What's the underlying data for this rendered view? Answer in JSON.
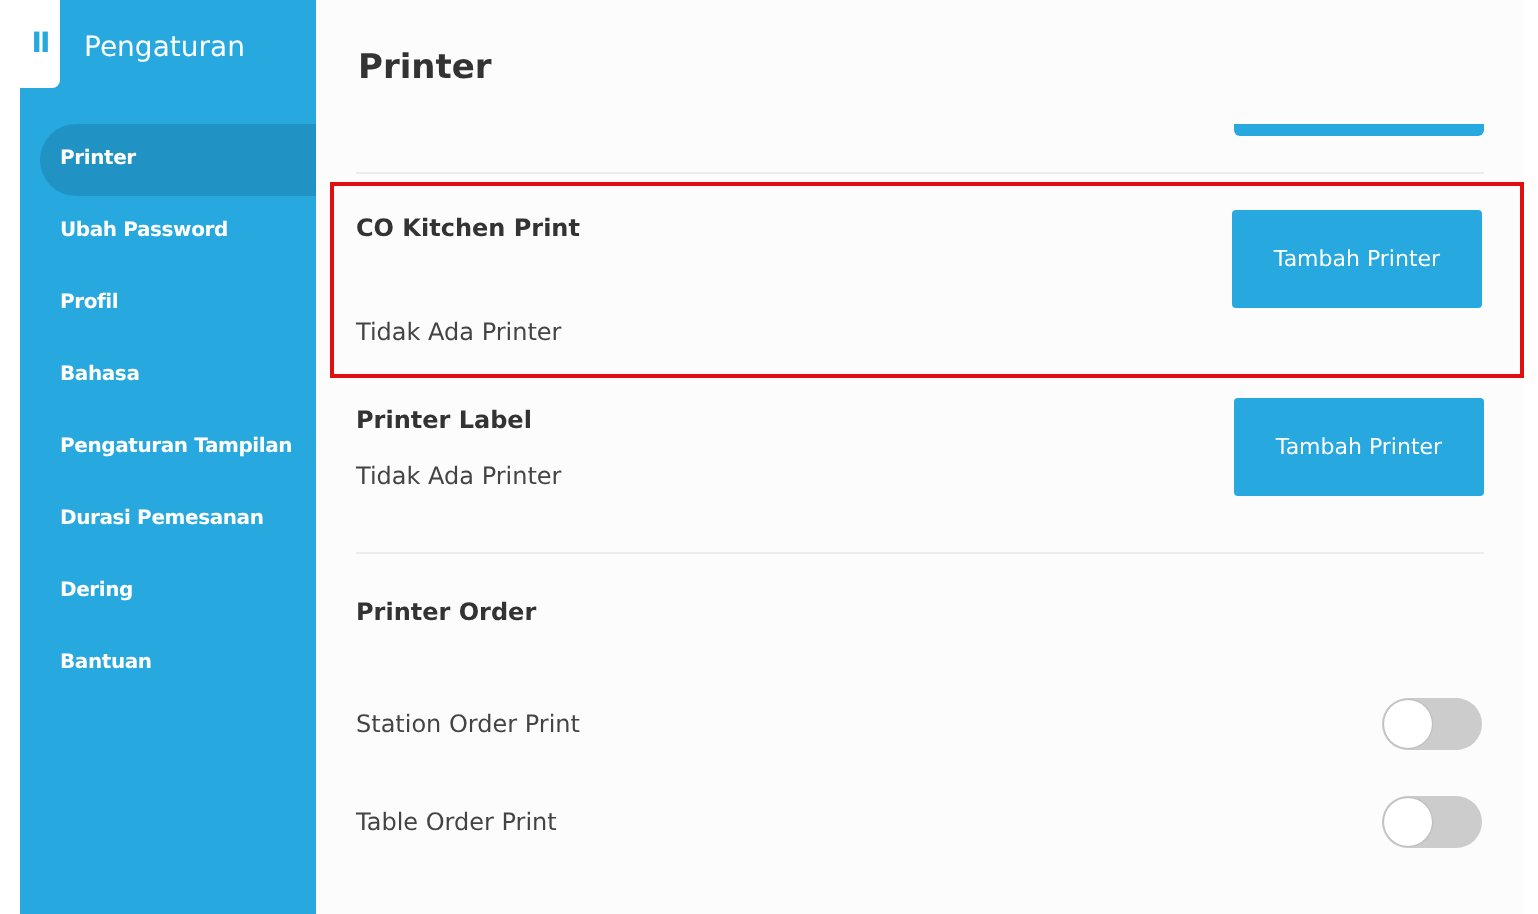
{
  "sidebar": {
    "title": "Pengaturan",
    "menu_glyph": "II",
    "items": [
      {
        "label": "Printer",
        "selected": true
      },
      {
        "label": "Ubah Password",
        "selected": false
      },
      {
        "label": "Profil",
        "selected": false
      },
      {
        "label": "Bahasa",
        "selected": false
      },
      {
        "label": "Pengaturan Tampilan",
        "selected": false
      },
      {
        "label": "Durasi Pemesanan",
        "selected": false
      },
      {
        "label": "Dering",
        "selected": false
      },
      {
        "label": "Bantuan",
        "selected": false
      }
    ]
  },
  "page_title": "Printer",
  "printer_sections": [
    {
      "title": "CO Kitchen Print",
      "status": "Tidak Ada Printer",
      "button": "Tambah Printer",
      "highlighted": true
    },
    {
      "title": "Printer Label",
      "status": "Tidak Ada Printer",
      "button": "Tambah Printer",
      "highlighted": false
    }
  ],
  "printer_order": {
    "title": "Printer Order",
    "toggles": [
      {
        "label": "Station Order Print",
        "on": false
      },
      {
        "label": "Table Order Print",
        "on": false
      }
    ]
  }
}
